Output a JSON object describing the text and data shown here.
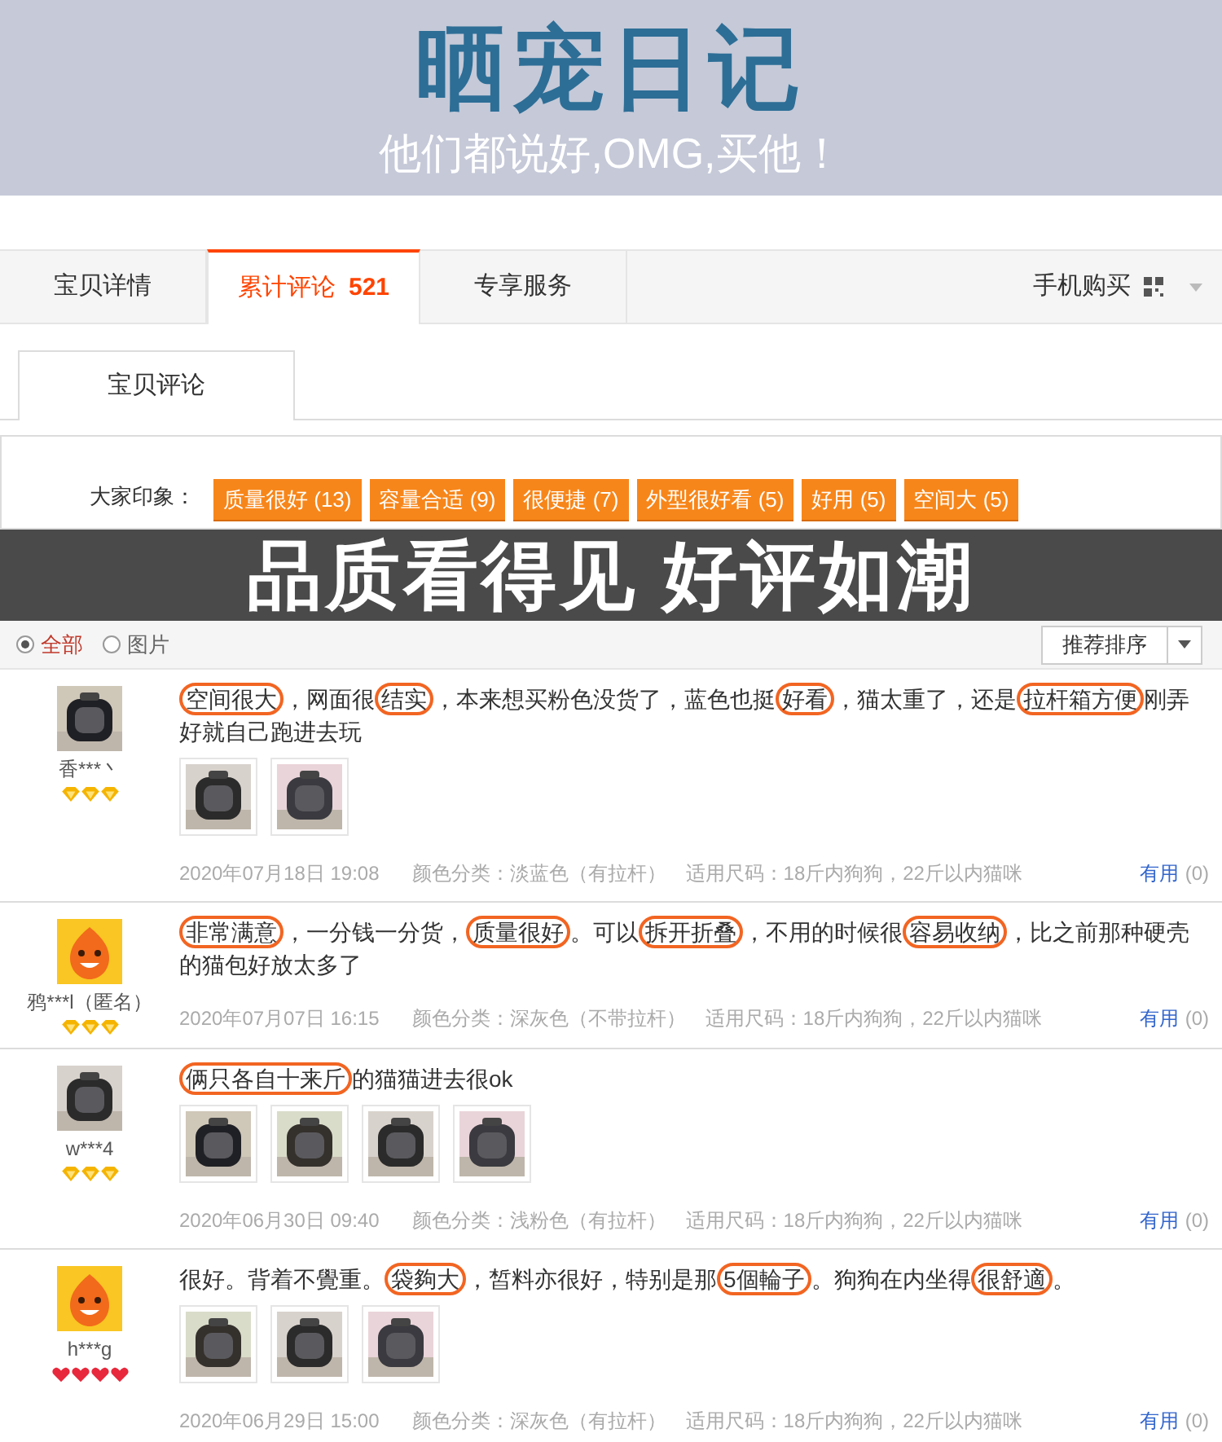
{
  "banner": {
    "title": "晒宠日记",
    "subtitle": "他们都说好,OMG,买他！"
  },
  "tabs": [
    {
      "label": "宝贝详情",
      "selected": false
    },
    {
      "label": "累计评论",
      "count": "521",
      "selected": true
    },
    {
      "label": "专享服务",
      "selected": false
    }
  ],
  "mobile_buy": "手机购买",
  "sub_tab": "宝贝评论",
  "impressions": {
    "label": "大家印象：",
    "tags": [
      "质量很好 (13)",
      "容量合适 (9)",
      "很便捷 (7)",
      "外型很好看 (5)",
      "好用 (5)",
      "空间大 (5)"
    ]
  },
  "overlay": "品质看得见 好评如潮",
  "filters": [
    {
      "label": "全部",
      "selected": true
    },
    {
      "label": "图片",
      "selected": false
    }
  ],
  "sort": "推荐排序",
  "reviews": [
    {
      "avatar": {
        "kind": "picture"
      },
      "user": "香***丶",
      "rank_icons": [
        {
          "kind": "diamond"
        },
        {
          "kind": "diamond"
        },
        {
          "kind": "diamond"
        }
      ],
      "segments": [
        {
          "text": "空间很大",
          "circled": true
        },
        {
          "text": "，网面很",
          "circled": false
        },
        {
          "text": "结实",
          "circled": true
        },
        {
          "text": "，本来想买粉色没货了，蓝色也挺",
          "circled": false
        },
        {
          "text": "好看",
          "circled": true
        },
        {
          "text": "，猫太重了，还是",
          "circled": false
        },
        {
          "text": "拉杆箱方便",
          "circled": true
        },
        {
          "text": "刚弄好就自己跑进去玩",
          "circled": false
        }
      ],
      "photos": [
        {
          "kind": "picture"
        },
        {
          "kind": "picture"
        }
      ],
      "date": "2020年07月18日 19:08",
      "variant": "颜色分类：淡蓝色（有拉杆）",
      "size": "适用尺码：18斤内狗狗，22斤以内猫咪",
      "useful": "有用",
      "useful_count": "(0)"
    },
    {
      "avatar": {
        "kind": "mascot"
      },
      "user": "鸦***l（匿名）",
      "rank_icons": [
        {
          "kind": "diamond"
        },
        {
          "kind": "diamond"
        },
        {
          "kind": "diamond"
        }
      ],
      "segments": [
        {
          "text": "非常满意",
          "circled": true
        },
        {
          "text": "，一分钱一分货，",
          "circled": false
        },
        {
          "text": "质量很好",
          "circled": true
        },
        {
          "text": "。可以",
          "circled": false
        },
        {
          "text": "拆开折叠",
          "circled": true
        },
        {
          "text": "，不用的时候很",
          "circled": false
        },
        {
          "text": "容易收纳",
          "circled": true
        },
        {
          "text": "，比之前那种硬壳的猫包好放太多了",
          "circled": false
        }
      ],
      "date": "2020年07月07日 16:15",
      "variant": "颜色分类：深灰色（不带拉杆）",
      "size": "适用尺码：18斤内狗狗，22斤以内猫咪",
      "useful": "有用",
      "useful_count": "(0)"
    },
    {
      "avatar": {
        "kind": "picture"
      },
      "user": "w***4",
      "rank_icons": [
        {
          "kind": "diamond"
        },
        {
          "kind": "diamond"
        },
        {
          "kind": "diamond"
        }
      ],
      "segments": [
        {
          "text": "俩只各自十来斤",
          "circled": true
        },
        {
          "text": "的猫猫进去很ok",
          "circled": false
        }
      ],
      "photos": [
        {
          "kind": "picture"
        },
        {
          "kind": "picture"
        },
        {
          "kind": "picture"
        },
        {
          "kind": "picture"
        }
      ],
      "date": "2020年06月30日 09:40",
      "variant": "颜色分类：浅粉色（有拉杆）",
      "size": "适用尺码：18斤内狗狗，22斤以内猫咪",
      "useful": "有用",
      "useful_count": "(0)"
    },
    {
      "avatar": {
        "kind": "mascot"
      },
      "user": "h***g",
      "rank_icons": [
        {
          "kind": "heart"
        },
        {
          "kind": "heart"
        },
        {
          "kind": "heart"
        },
        {
          "kind": "heart"
        }
      ],
      "segments": [
        {
          "text": "很好。背着不覺重。",
          "circled": false
        },
        {
          "text": "袋夠大",
          "circled": true
        },
        {
          "text": "，皙料亦很好，特别是那",
          "circled": false
        },
        {
          "text": "5個輪子",
          "circled": true
        },
        {
          "text": "。狗狗在内坐得",
          "circled": false
        },
        {
          "text": "很舒適",
          "circled": true
        },
        {
          "text": "。",
          "circled": false
        }
      ],
      "photos": [
        {
          "kind": "picture"
        },
        {
          "kind": "picture"
        },
        {
          "kind": "picture"
        }
      ],
      "date": "2020年06月29日 15:00",
      "variant": "颜色分类：深灰色（有拉杆）",
      "size": "适用尺码：18斤内狗狗，22斤以内猫咪",
      "useful": "有用",
      "useful_count": "(0)"
    }
  ]
}
